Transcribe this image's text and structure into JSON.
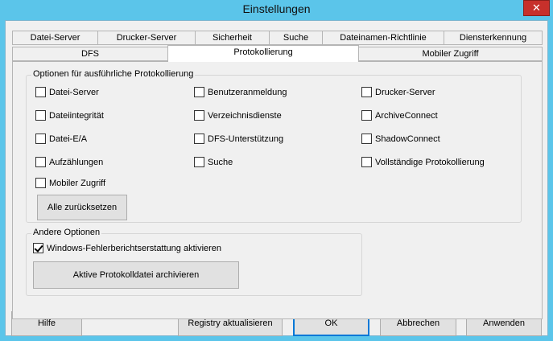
{
  "window": {
    "title": "Einstellungen",
    "close_glyph": "✕"
  },
  "tabs_row1": [
    "Datei-Server",
    "Drucker-Server",
    "Sicherheit",
    "Suche",
    "Dateinamen-Richtlinie",
    "Diensterkennung"
  ],
  "tabs_row2": [
    "DFS",
    "Protokollierung",
    "Mobiler Zugriff"
  ],
  "logging": {
    "group_title": "Optionen für ausführliche Protokollierung",
    "col1": [
      "Datei-Server",
      "Dateiintegrität",
      "Datei-E/A",
      "Aufzählungen",
      "Mobiler Zugriff"
    ],
    "col2": [
      "Benutzeranmeldung",
      "Verzeichnisdienste",
      "DFS-Unterstützung",
      "Suche"
    ],
    "col3": [
      "Drucker-Server",
      "ArchiveConnect",
      "ShadowConnect",
      "Vollständige Protokollierung"
    ],
    "reset_button": "Alle zurücksetzen"
  },
  "other": {
    "group_title": "Andere Optionen",
    "checkbox_label": "Windows-Fehlerberichtserstattung aktivieren",
    "checkbox_checked": true,
    "archive_button": "Aktive Protokolldatei archivieren"
  },
  "footer": {
    "help": "Hilfe",
    "registry": "Registry aktualisieren",
    "ok": "OK",
    "cancel": "Abbrechen",
    "apply": "Anwenden"
  }
}
